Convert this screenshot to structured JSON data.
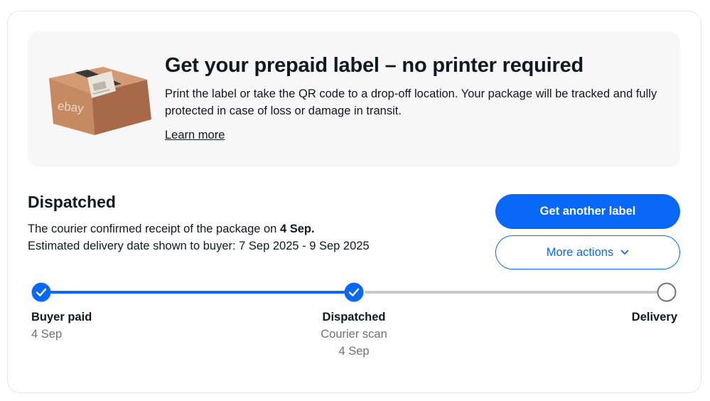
{
  "promo": {
    "title": "Get your prepaid label – no printer required",
    "description": "Print the label or take the QR code to a drop-off location. Your package will be tracked and fully protected in case of loss or damage in transit.",
    "learn_more": "Learn more",
    "box_brand": "ebay"
  },
  "status": {
    "title": "Dispatched",
    "line1_prefix": "The courier confirmed receipt of the package on ",
    "line1_date": "4 Sep.",
    "line2": "Estimated delivery date shown to buyer: 7 Sep 2025 - 9 Sep 2025"
  },
  "actions": {
    "primary_label": "Get another label",
    "secondary_label": "More actions"
  },
  "progress": {
    "steps": [
      {
        "label": "Buyer paid",
        "sub1": "4 Sep",
        "sub2": "",
        "state": "complete"
      },
      {
        "label": "Dispatched",
        "sub1": "Courier scan",
        "sub2": "4 Sep",
        "state": "complete"
      },
      {
        "label": "Delivery",
        "sub1": "",
        "sub2": "",
        "state": "pending"
      }
    ]
  },
  "colors": {
    "accent": "#0968f6",
    "text": "#111820",
    "muted": "#707070",
    "promo_bg": "#f7f7f7",
    "track_pending": "#c7c7c7",
    "box": "#c68a63"
  }
}
